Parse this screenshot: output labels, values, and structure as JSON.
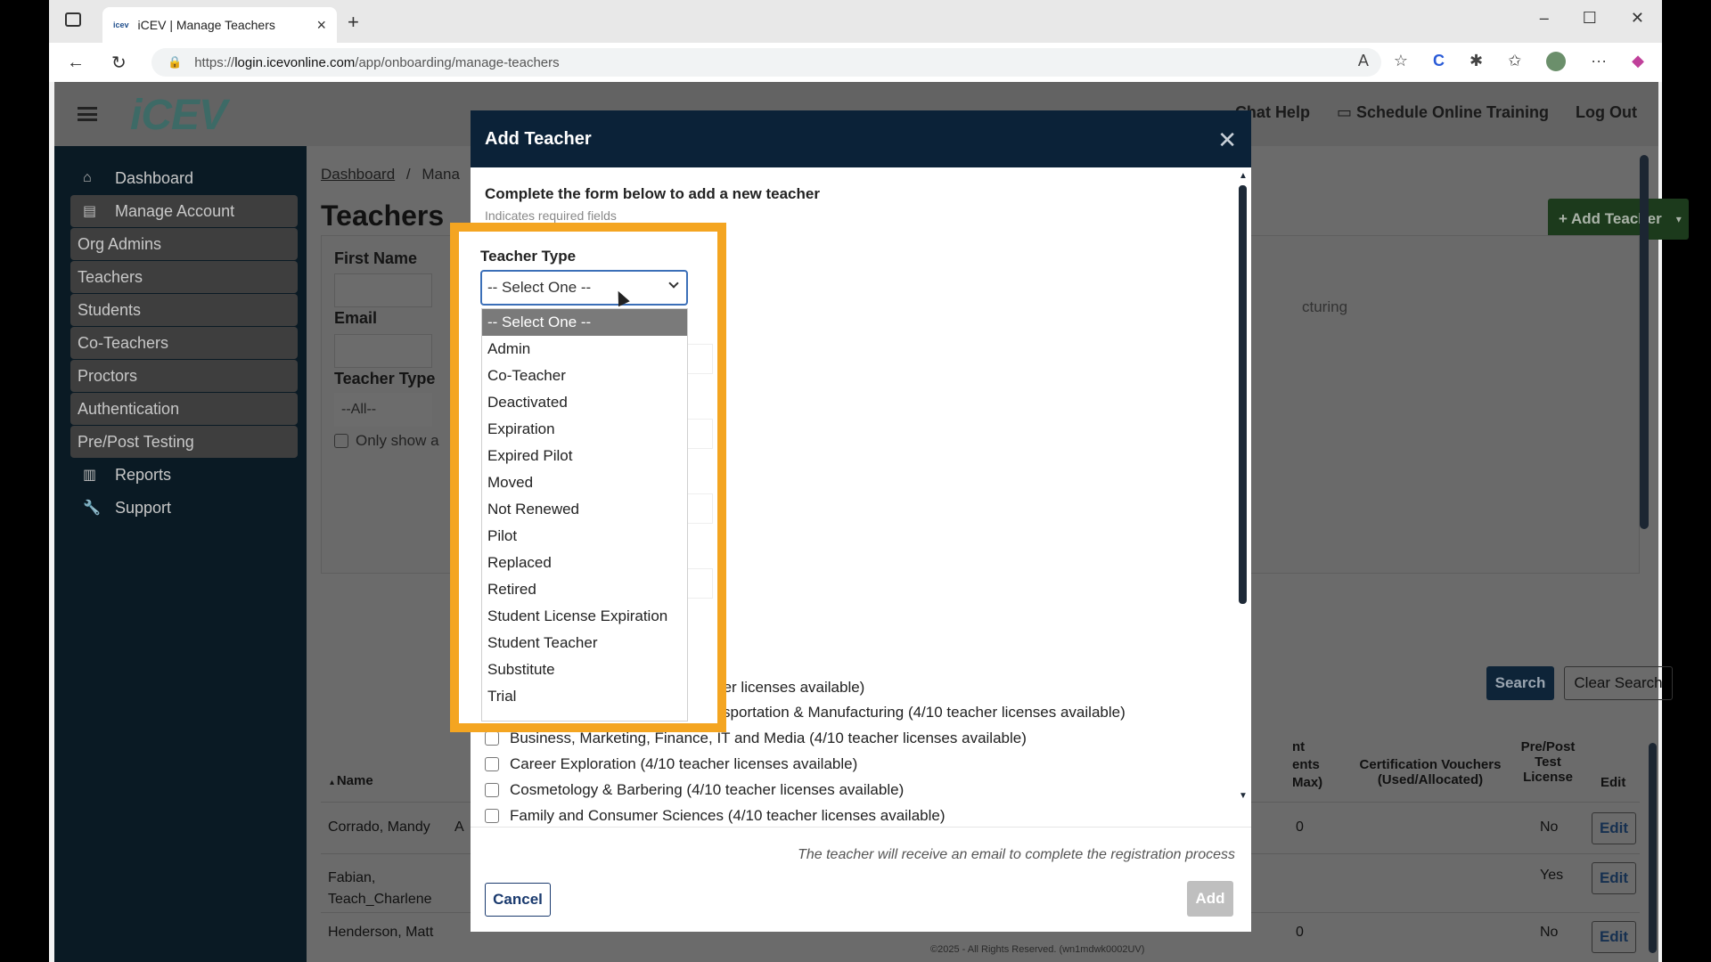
{
  "browser": {
    "tab_title": "iCEV | Manage Teachers",
    "tab_favicon": "icev",
    "url_prefix": "https://",
    "url_host": "login.icevonline.com",
    "url_path": "/app/onboarding/manage-teachers"
  },
  "header": {
    "logo": "iCEV",
    "chat_help": "Chat Help",
    "schedule_training": "Schedule Online Training",
    "logout": "Log Out"
  },
  "sidebar": {
    "items": [
      {
        "label": "Dashboard",
        "icon": "home-icon"
      },
      {
        "label": "Manage Account",
        "icon": "account-icon"
      },
      {
        "label": "Org Admins"
      },
      {
        "label": "Teachers"
      },
      {
        "label": "Students"
      },
      {
        "label": "Co-Teachers"
      },
      {
        "label": "Proctors"
      },
      {
        "label": "Authentication"
      },
      {
        "label": "Pre/Post Testing"
      },
      {
        "label": "Reports",
        "icon": "reports-icon"
      },
      {
        "label": "Support",
        "icon": "wrench-icon"
      }
    ]
  },
  "main": {
    "breadcrumb_home": "Dashboard",
    "breadcrumb_sep": "/",
    "breadcrumb_current": "Mana",
    "title": "Teachers",
    "add_teacher_button": "+ Add Teacher",
    "filters": {
      "first_name_label": "First Name",
      "email_label": "Email",
      "teacher_type_label": "Teacher Type",
      "teacher_type_value": "--All--",
      "only_show_label": "Only show a",
      "partial_caption": "cturing"
    },
    "search_button": "Search",
    "clear_search_button": "Clear Search",
    "table": {
      "headers": {
        "name": "Name",
        "students_a": "nt",
        "students_b": "ents",
        "students_c": "Max)",
        "vouchers": "Certification Vouchers (Used/Allocated)",
        "prepost": "Pre/Post Test License",
        "edit": "Edit"
      },
      "rows": [
        {
          "name": "Corrado, Mandy",
          "col_a": "A",
          "students": "0",
          "prepost": "No",
          "edit": "Edit"
        },
        {
          "name": "Fabian, Teach_Charlene",
          "col_a": "",
          "students": "",
          "prepost": "Yes",
          "edit": "Edit"
        },
        {
          "name": "Henderson, Matt",
          "col_a": "",
          "students": "0",
          "prepost": "No",
          "edit": "Edit"
        }
      ]
    },
    "copyright": "©2025 - All Rights Reserved. (wn1mdwk0002UV)"
  },
  "modal": {
    "title": "Add Teacher",
    "intro": "Complete the form below to add a new teacher",
    "required_note": "Indicates required fields",
    "teacher_type_label": "Teacher Type",
    "teacher_type_value": "-- Select One --",
    "options": [
      "-- Select One --",
      "Admin",
      "Co-Teacher",
      "Deactivated",
      "Expiration",
      "Expired Pilot",
      "Moved",
      "Not Renewed",
      "Pilot",
      "Replaced",
      "Retired",
      "Student License Expiration",
      "Student Teacher",
      "Substitute",
      "Trial"
    ],
    "licenses": [
      "teacher licenses available)",
      "Architecture, Construction, Transportation & Manufacturing (4/10 teacher licenses available)",
      "Business, Marketing, Finance, IT and Media (4/10 teacher licenses available)",
      "Career Exploration (4/10 teacher licenses available)",
      "Cosmetology & Barbering (4/10 teacher licenses available)",
      "Family and Consumer Sciences (4/10 teacher licenses available)"
    ],
    "registration_note": "The teacher will receive an email to complete the registration process",
    "cancel_button": "Cancel",
    "add_button": "Add"
  },
  "colors": {
    "highlight": "#f4a521",
    "modal_header": "#0b2238",
    "sidebar": "#0a1a24"
  }
}
